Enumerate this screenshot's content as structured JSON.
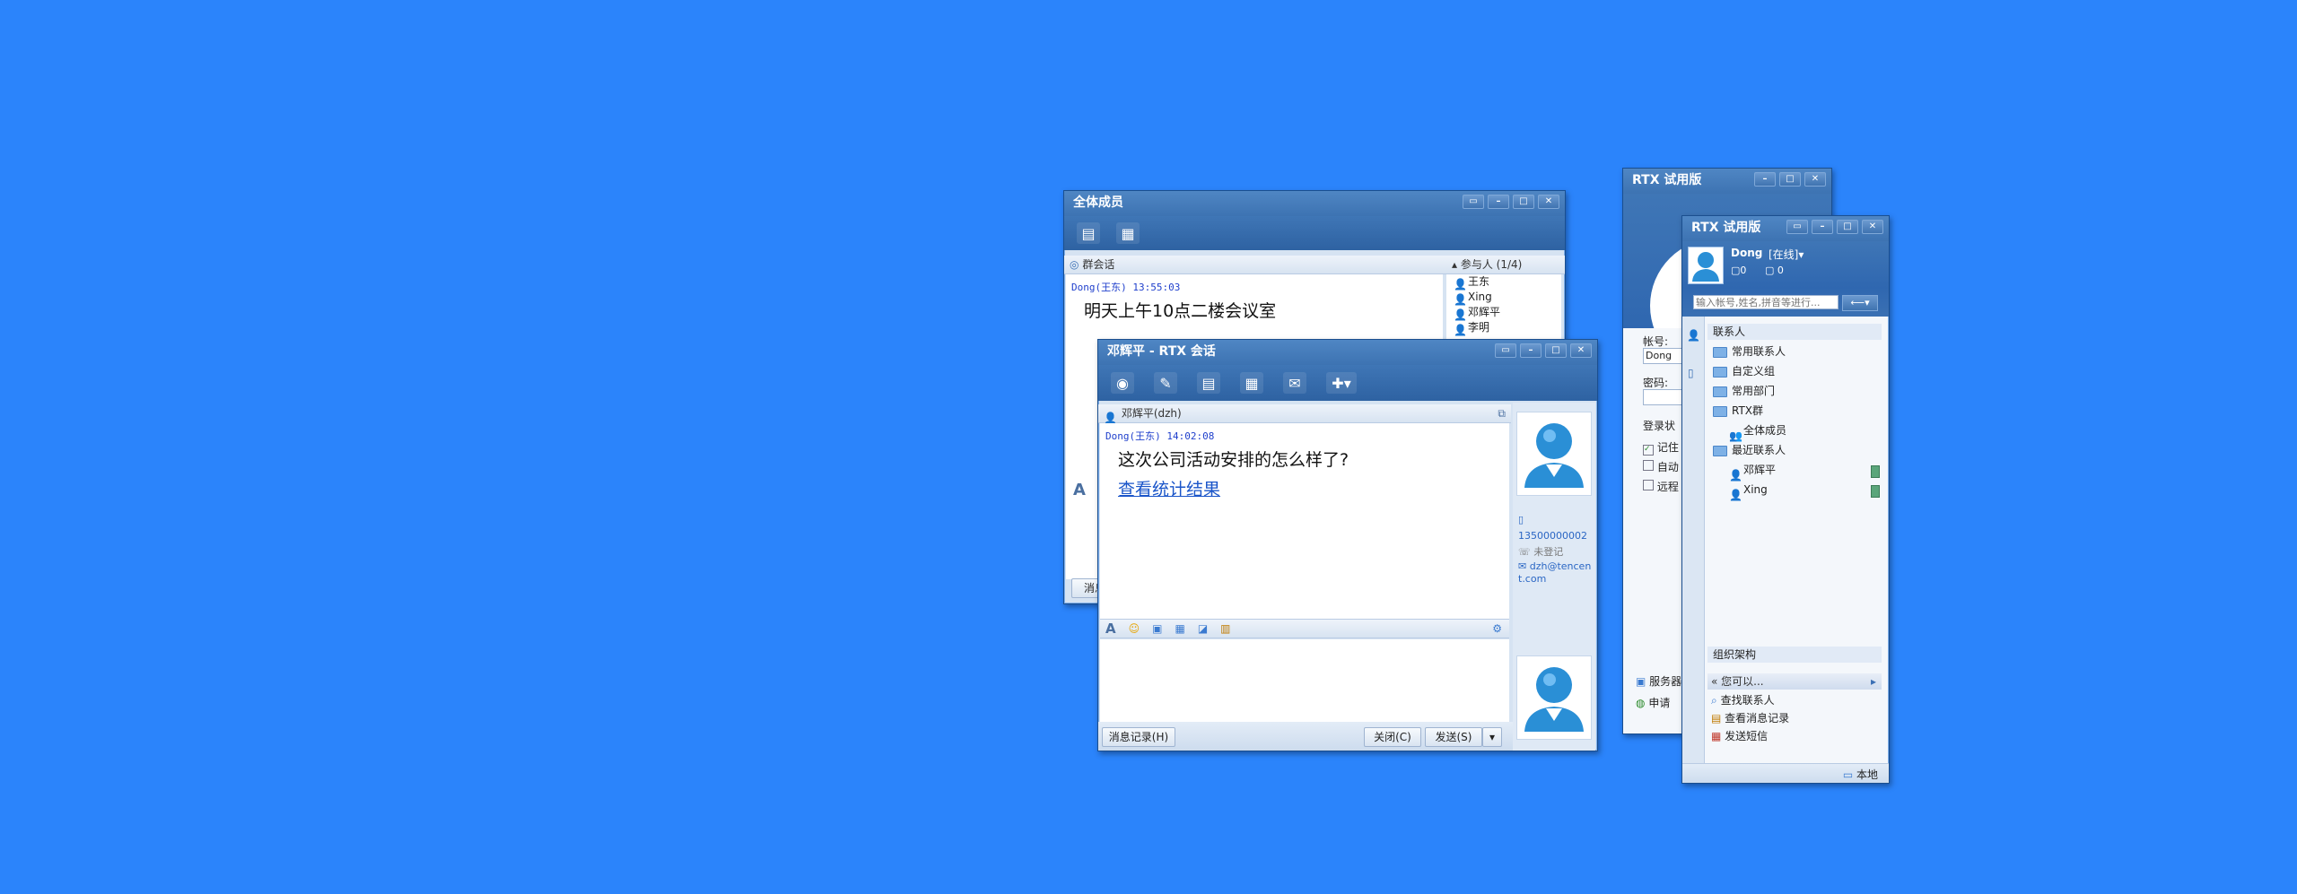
{
  "group_window": {
    "title": "全体成员",
    "session_label": "群会话",
    "participants_label": "参与人 (1/4)",
    "participants": [
      "王东",
      "Xing",
      "邓辉平",
      "李明"
    ],
    "messages": [
      {
        "sender": "Dong(王东) 13:55:03",
        "text": "明天上午10点二楼会议室"
      }
    ],
    "history_label": "消息"
  },
  "chat_window": {
    "title": "邓辉平 - RTX 会话",
    "contact_label": "邓辉平(dzh)",
    "messages": [
      {
        "sender": "Dong(王东) 14:02:08",
        "text": "这次公司活动安排的怎么样了?",
        "link": "查看统计结果"
      }
    ],
    "contact_info": {
      "phone": "13500000002",
      "landline": "未登记",
      "email": "dzh@tencent.com"
    },
    "history_button": "消息记录(H)",
    "close_button": "关闭(C)",
    "send_button": "发送(S)"
  },
  "login_window": {
    "title": "RTX 试用版",
    "account_label": "帐号:",
    "account_value": "Dong",
    "password_label": "密码:",
    "status_label": "登录状",
    "checkboxes": [
      {
        "label": "记住",
        "checked": true
      },
      {
        "label": "自动",
        "checked": false
      },
      {
        "label": "远程",
        "checked": false
      }
    ],
    "links": [
      "服务器",
      "申请"
    ]
  },
  "main_window": {
    "title": "RTX 试用版",
    "user_name": "Dong",
    "status": "[在线]",
    "counters": [
      "0",
      "0"
    ],
    "search_placeholder": "输入帐号,姓名,拼音等进行...",
    "contacts_header": "联系人",
    "tree": [
      {
        "label": "常用联系人",
        "type": "folder",
        "level": 0
      },
      {
        "label": "自定义组",
        "type": "folder",
        "level": 0
      },
      {
        "label": "常用部门",
        "type": "folder",
        "level": 0
      },
      {
        "label": "RTX群",
        "type": "folder",
        "level": 0
      },
      {
        "label": "全体成员",
        "type": "group",
        "level": 1
      },
      {
        "label": "最近联系人",
        "type": "folder",
        "level": 0
      },
      {
        "label": "邓辉平",
        "type": "person",
        "level": 1
      },
      {
        "label": "Xing",
        "type": "person",
        "level": 1
      }
    ],
    "org_header": "组织架构",
    "can_do_header": "您可以...",
    "actions": [
      "查找联系人",
      "查看消息记录",
      "发送短信"
    ],
    "footer_label": "本地"
  }
}
